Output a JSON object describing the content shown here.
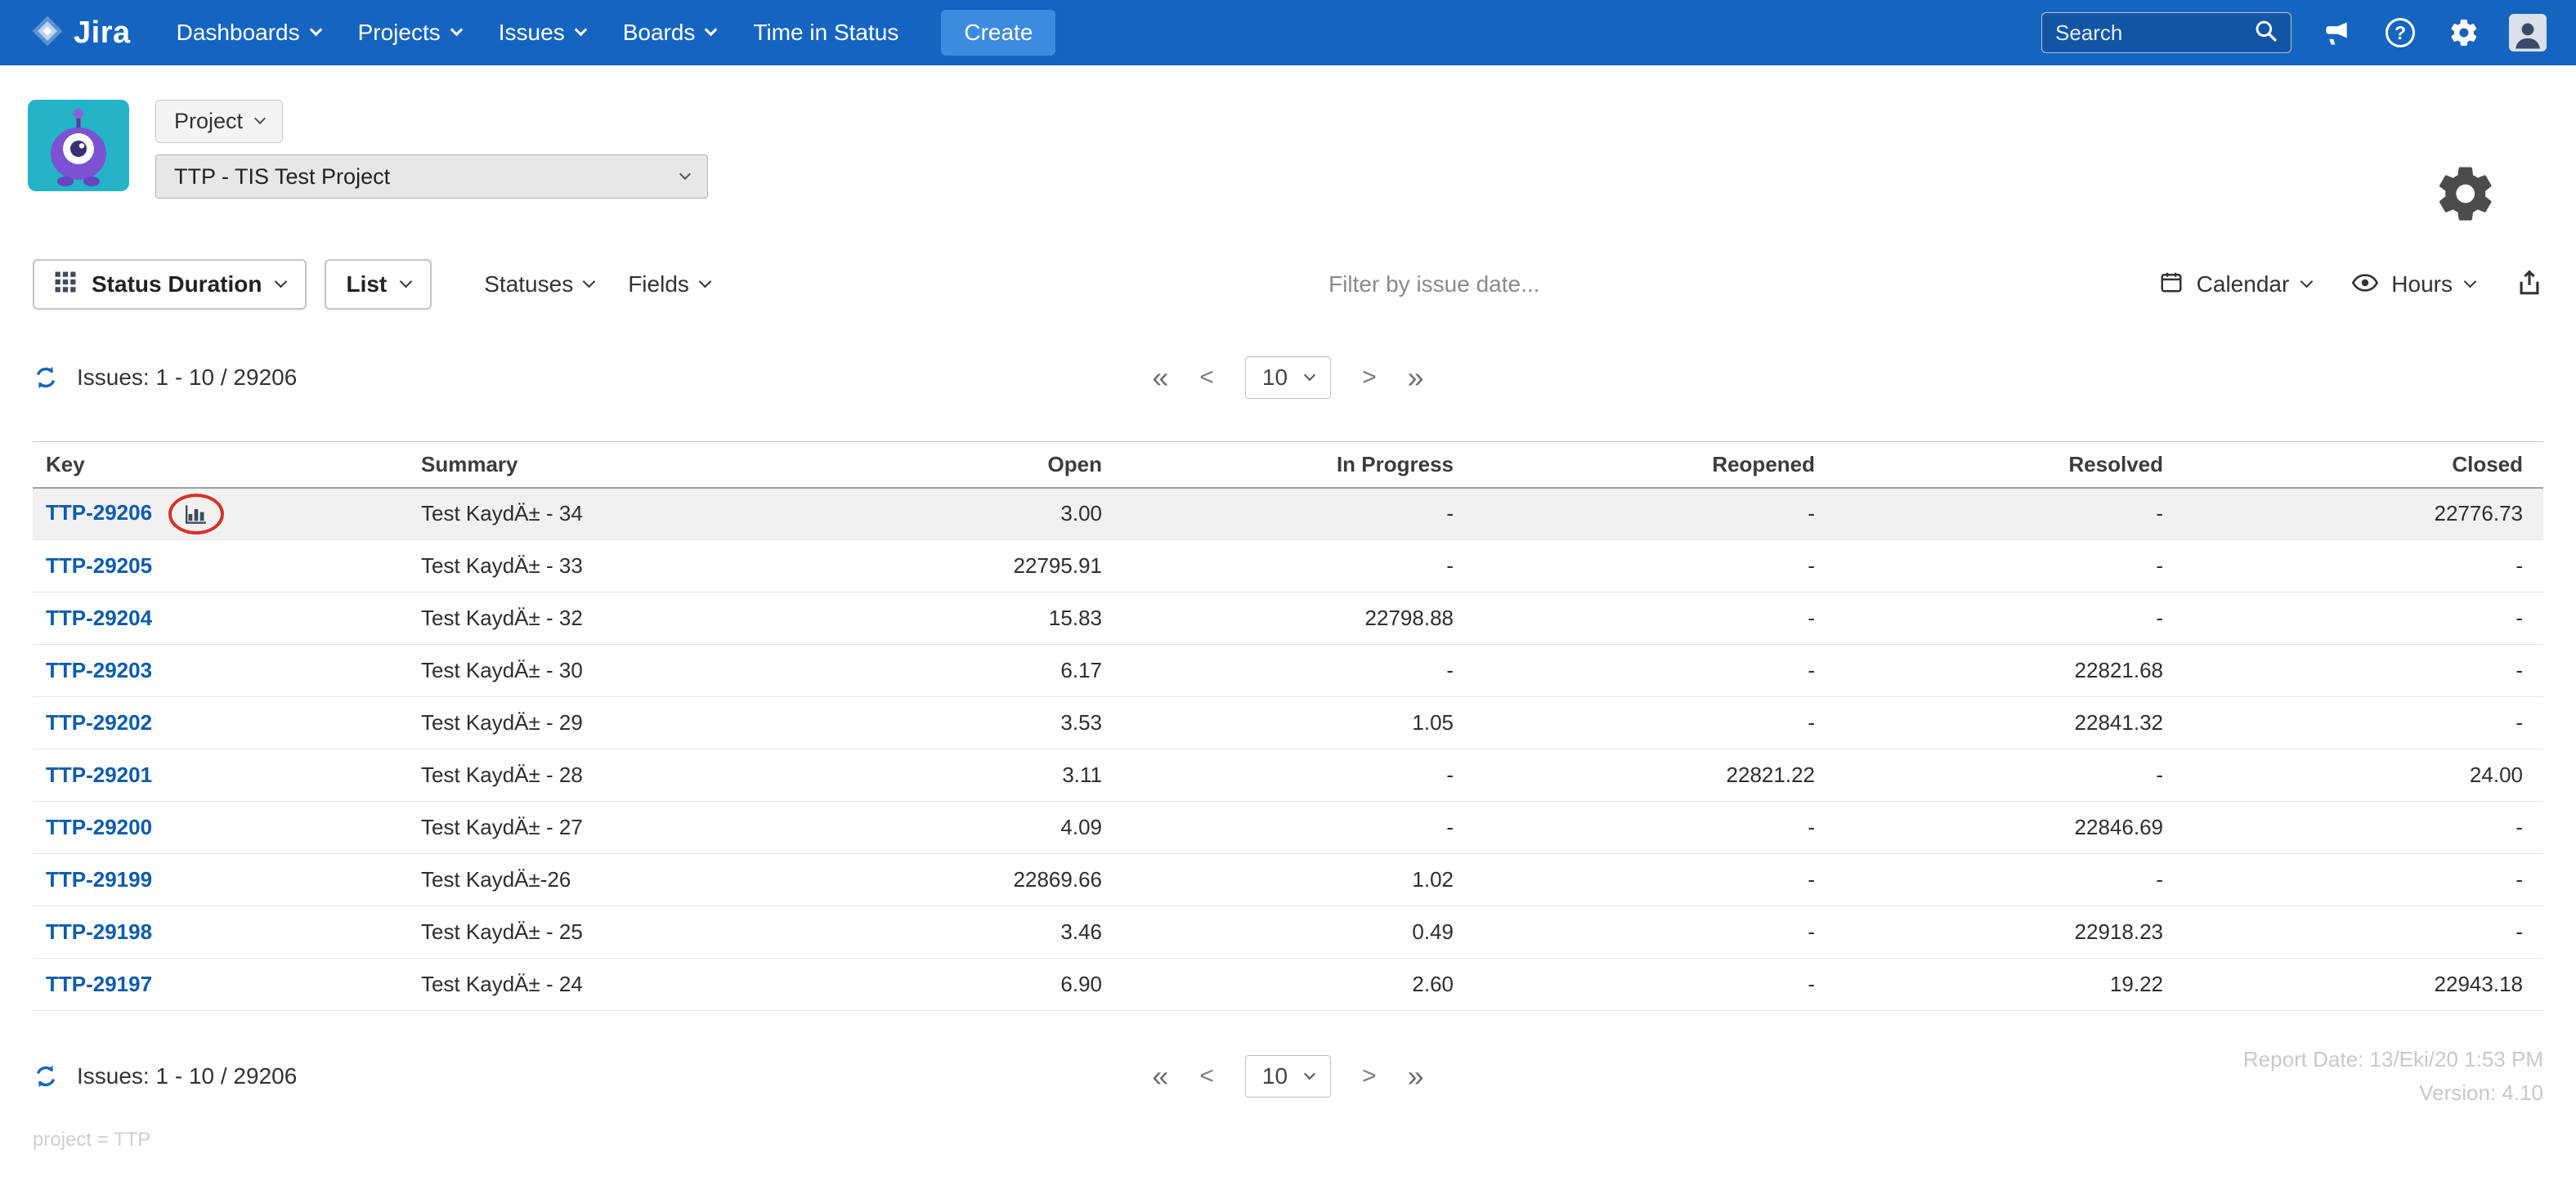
{
  "nav": {
    "brand": "Jira",
    "items": [
      {
        "label": "Dashboards"
      },
      {
        "label": "Projects"
      },
      {
        "label": "Issues"
      },
      {
        "label": "Boards"
      },
      {
        "label": "Time in Status"
      }
    ],
    "create_label": "Create",
    "search_placeholder": "Search",
    "help_symbol": "?"
  },
  "project_header": {
    "project_button_label": "Project",
    "project_select_value": "TTP - TIS Test Project"
  },
  "toolbar": {
    "report_type_label": "Status Duration",
    "view_label": "List",
    "statuses_label": "Statuses",
    "fields_label": "Fields",
    "filter_placeholder": "Filter by issue date...",
    "calendar_label": "Calendar",
    "units_label": "Hours"
  },
  "issues_bar": {
    "count_text": "Issues: 1 - 10 / 29206"
  },
  "pagination": {
    "first": "«",
    "prev": "<",
    "page_size": "10",
    "next": ">",
    "last": "»"
  },
  "table": {
    "columns": [
      "Key",
      "Summary",
      "Open",
      "In Progress",
      "Reopened",
      "Resolved",
      "Closed"
    ],
    "rows": [
      {
        "key": "TTP-29206",
        "summary": "Test KaydÄ± - 34",
        "open": "3.00",
        "in_progress": "-",
        "reopened": "-",
        "resolved": "-",
        "closed": "22776.73",
        "highlighted": true,
        "chart_annotated": true
      },
      {
        "key": "TTP-29205",
        "summary": "Test KaydÄ± - 33",
        "open": "22795.91",
        "in_progress": "-",
        "reopened": "-",
        "resolved": "-",
        "closed": "-"
      },
      {
        "key": "TTP-29204",
        "summary": "Test KaydÄ± - 32",
        "open": "15.83",
        "in_progress": "22798.88",
        "reopened": "-",
        "resolved": "-",
        "closed": "-"
      },
      {
        "key": "TTP-29203",
        "summary": "Test KaydÄ± - 30",
        "open": "6.17",
        "in_progress": "-",
        "reopened": "-",
        "resolved": "22821.68",
        "closed": "-"
      },
      {
        "key": "TTP-29202",
        "summary": "Test KaydÄ± - 29",
        "open": "3.53",
        "in_progress": "1.05",
        "reopened": "-",
        "resolved": "22841.32",
        "closed": "-"
      },
      {
        "key": "TTP-29201",
        "summary": "Test KaydÄ± - 28",
        "open": "3.11",
        "in_progress": "-",
        "reopened": "22821.22",
        "resolved": "-",
        "closed": "24.00"
      },
      {
        "key": "TTP-29200",
        "summary": "Test KaydÄ± - 27",
        "open": "4.09",
        "in_progress": "-",
        "reopened": "-",
        "resolved": "22846.69",
        "closed": "-"
      },
      {
        "key": "TTP-29199",
        "summary": "Test KaydÄ±-26",
        "open": "22869.66",
        "in_progress": "1.02",
        "reopened": "-",
        "resolved": "-",
        "closed": "-"
      },
      {
        "key": "TTP-29198",
        "summary": "Test KaydÄ± - 25",
        "open": "3.46",
        "in_progress": "0.49",
        "reopened": "-",
        "resolved": "22918.23",
        "closed": "-"
      },
      {
        "key": "TTP-29197",
        "summary": "Test KaydÄ± - 24",
        "open": "6.90",
        "in_progress": "2.60",
        "reopened": "-",
        "resolved": "19.22",
        "closed": "22943.18"
      }
    ]
  },
  "footer": {
    "report_date": "Report Date: 13/Eki/20 1:53 PM",
    "version": "Version: 4.10",
    "query": "project = TTP"
  },
  "colors": {
    "nav_bg": "#1565c0",
    "create_bg": "#3d8be0",
    "link": "#0b5cad",
    "annotation": "#dc3029",
    "row_highlight": "#f1f1f1"
  }
}
